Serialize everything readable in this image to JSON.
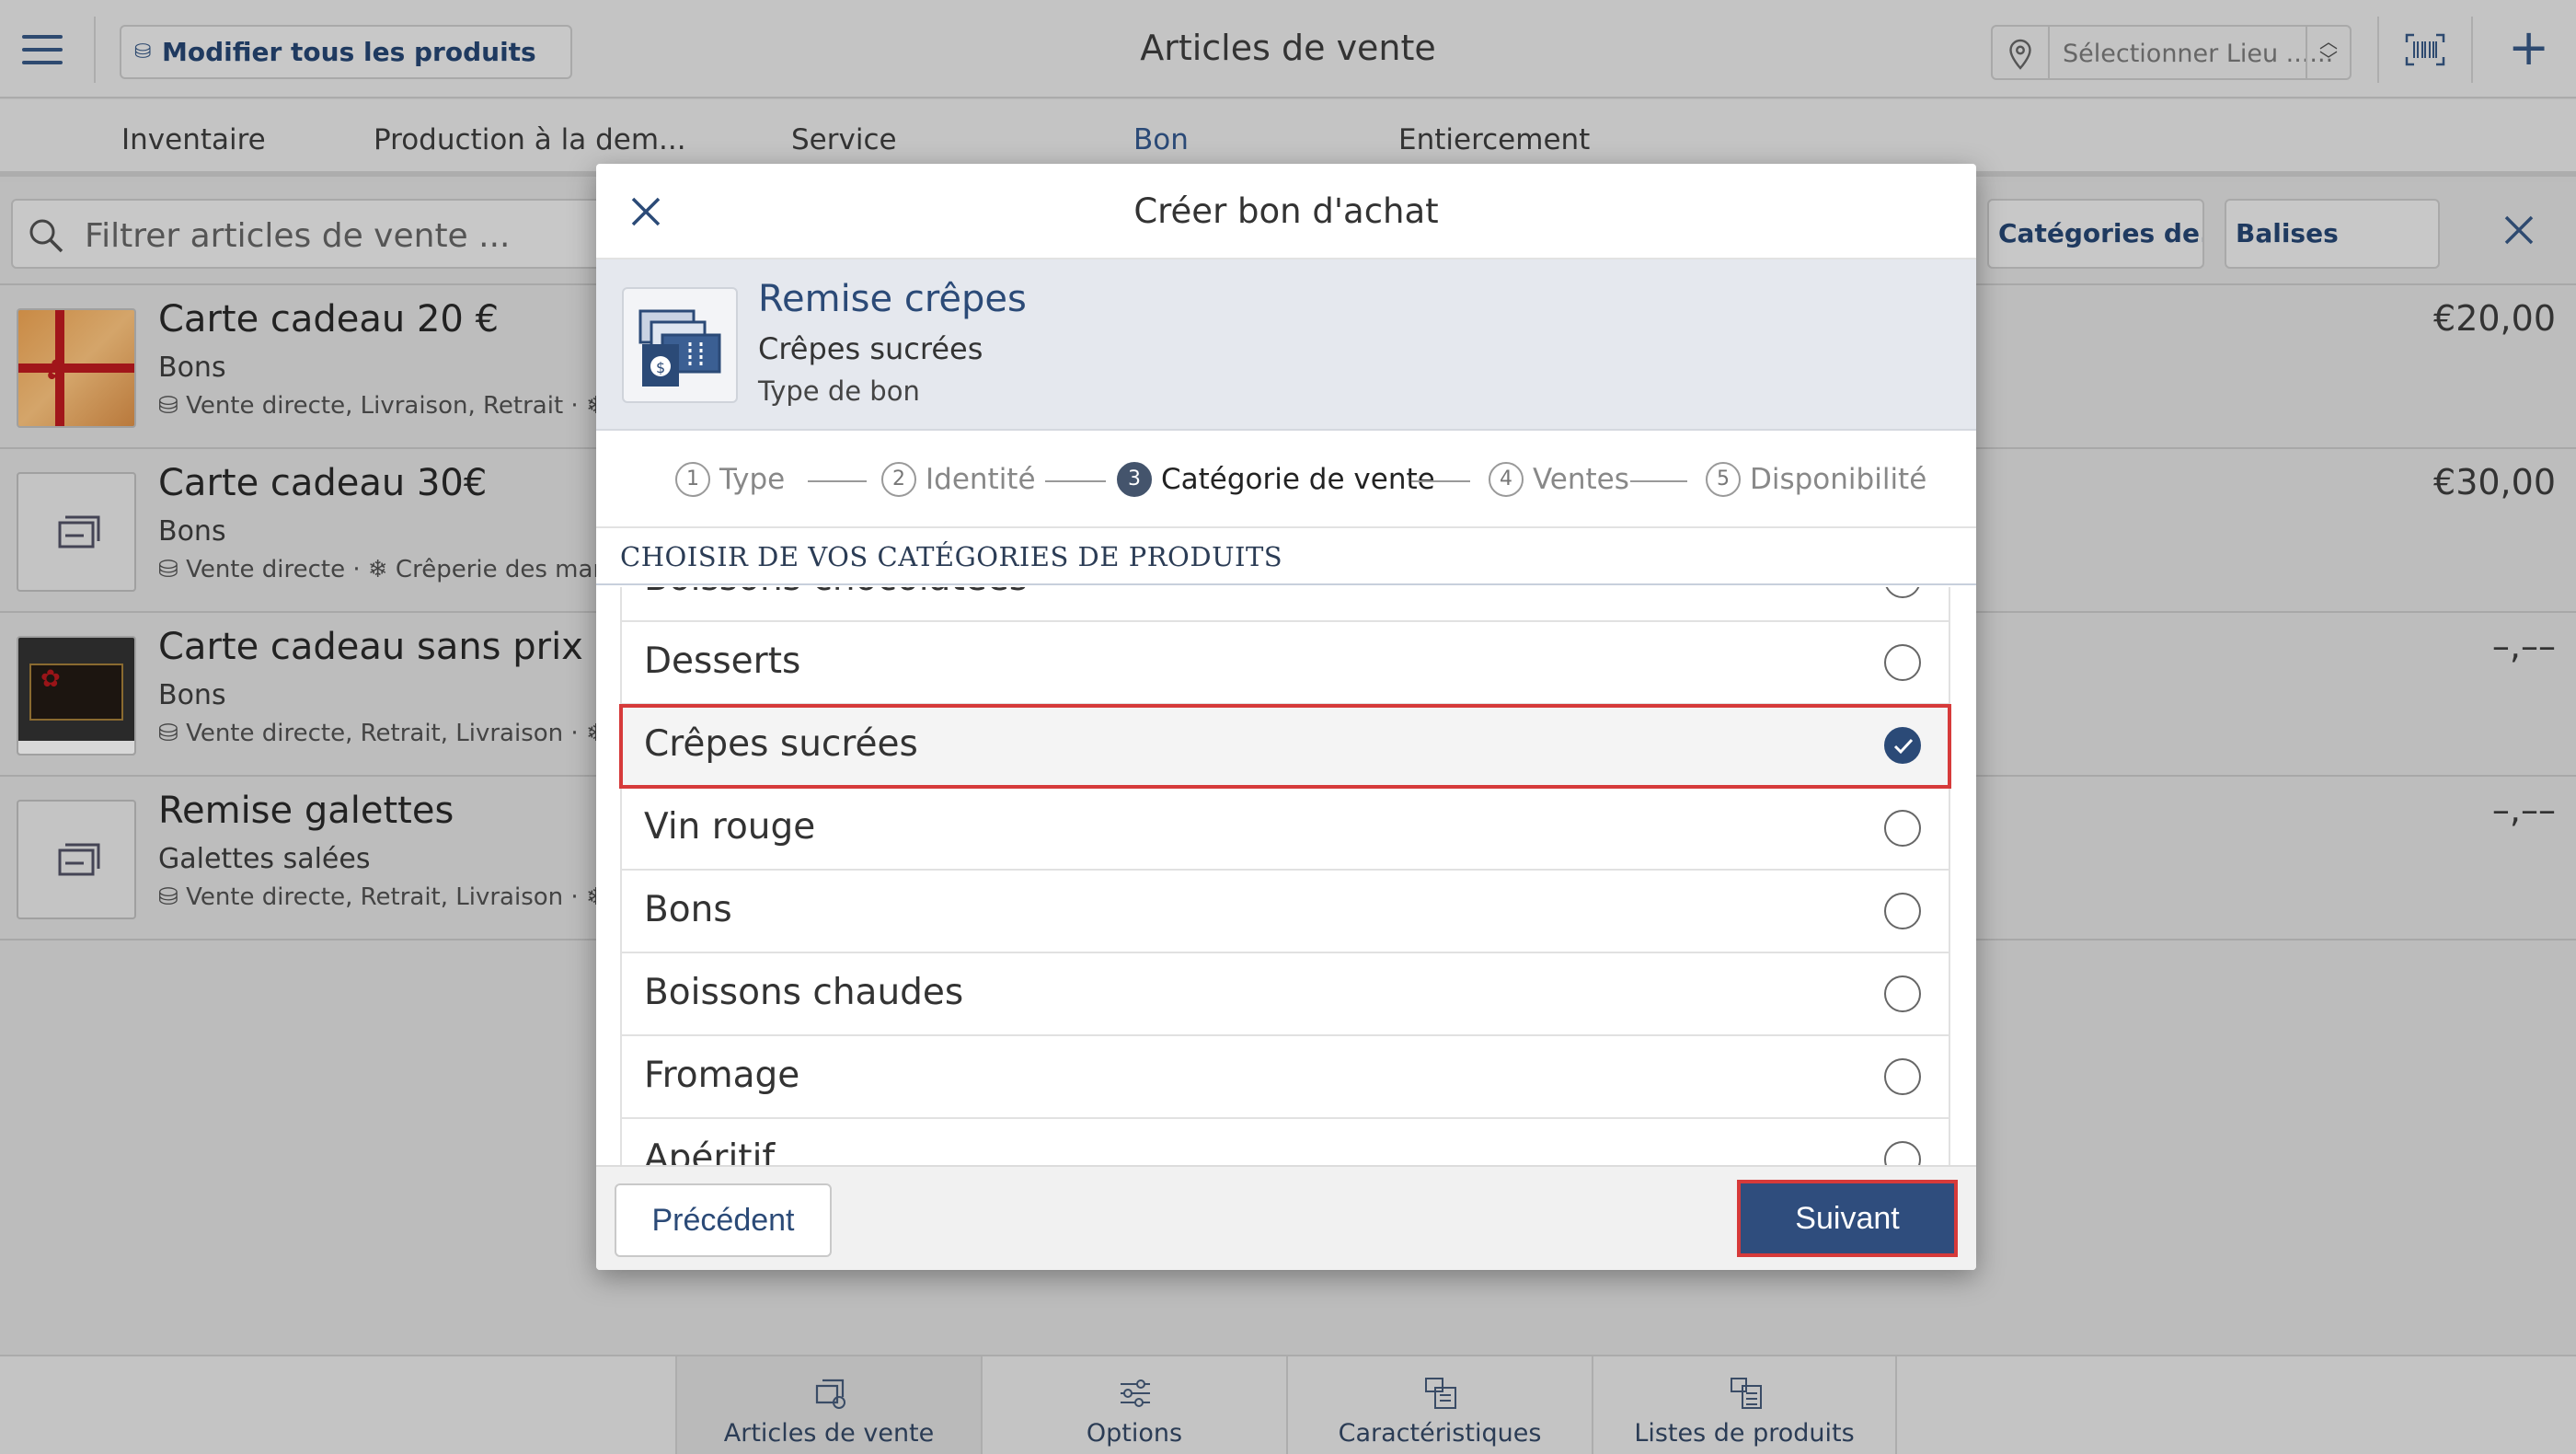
{
  "header": {
    "modify_all": "Modifier tous les produits",
    "title": "Articles de vente",
    "location_placeholder": "Sélectionner Lieu ......",
    "add": "+"
  },
  "tabs": [
    {
      "label": "Inventaire"
    },
    {
      "label": "Production à la dem..."
    },
    {
      "label": "Service"
    },
    {
      "label": "Bon"
    },
    {
      "label": "Entiercement"
    }
  ],
  "filter": {
    "placeholder": "Filtrer articles de vente ...",
    "categories_chip": "Catégories de...",
    "tags_chip": "Balises"
  },
  "items": [
    {
      "name": "Carte cadeau 20 €",
      "category": "Bons",
      "meta": "Vente directe, Livraison, Retrait · ❄ Cr",
      "price": "€20,00"
    },
    {
      "name": "Carte cadeau 30€",
      "category": "Bons",
      "meta": "Vente directe · ❄ Crêperie des marins",
      "price": "€30,00"
    },
    {
      "name": "Carte cadeau sans prix",
      "category": "Bons",
      "meta": "Vente directe, Retrait, Livraison · ❄ Cr",
      "price": "–,––"
    },
    {
      "name": "Remise galettes",
      "category": "Galettes salées",
      "meta": "Vente directe, Retrait, Livraison · ❄ Cr",
      "price": "–,––"
    }
  ],
  "bottom_nav": [
    {
      "label": "Articles de vente"
    },
    {
      "label": "Options"
    },
    {
      "label": "Caractéristiques"
    },
    {
      "label": "Listes de produits"
    }
  ],
  "modal": {
    "title": "Créer bon d'achat",
    "product": {
      "name": "Remise crêpes",
      "category": "Crêpes sucrées",
      "type": "Type de bon"
    },
    "steps": [
      {
        "num": "1",
        "label": "Type"
      },
      {
        "num": "2",
        "label": "Identité"
      },
      {
        "num": "3",
        "label": "Catégorie de vente"
      },
      {
        "num": "4",
        "label": "Ventes"
      },
      {
        "num": "5",
        "label": "Disponibilité"
      }
    ],
    "active_step": 3,
    "section_title": "CHOISIR DE VOS CATÉGORIES DE PRODUITS",
    "categories": [
      {
        "label": "Boissons chocolatées",
        "selected": false
      },
      {
        "label": "Desserts",
        "selected": false
      },
      {
        "label": "Crêpes sucrées",
        "selected": true
      },
      {
        "label": "Vin rouge",
        "selected": false
      },
      {
        "label": "Bons",
        "selected": false
      },
      {
        "label": "Boissons chaudes",
        "selected": false
      },
      {
        "label": "Fromage",
        "selected": false
      },
      {
        "label": "Apéritif",
        "selected": false
      }
    ],
    "prev_label": "Précédent",
    "next_label": "Suivant"
  },
  "colors": {
    "accent": "#2f4d7d",
    "highlight": "#d63a3a"
  }
}
